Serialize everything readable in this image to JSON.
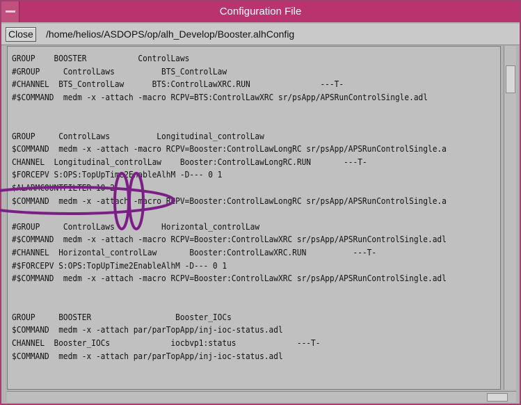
{
  "window": {
    "title": "Configuration File"
  },
  "toolbar": {
    "close_label": "Close",
    "file_path": "/home/helios/ASDOPS/op/alh_Develop/Booster.alhConfig"
  },
  "file_lines": [
    "GROUP    BOOSTER           ControlLaws",
    "#GROUP     ControlLaws          BTS_ControlLaw",
    "#CHANNEL  BTS_ControlLaw      BTS:ControlLawXRC.RUN               ---T-",
    "#$COMMAND  medm -x -attach -macro RCPV=BTS:ControlLawXRC sr/psApp/APSRunControlSingle.adl",
    "",
    "",
    "GROUP     ControlLaws          Longitudinal_controlLaw",
    "$COMMAND  medm -x -attach -macro RCPV=Booster:ControlLawLongRC sr/psApp/APSRunControlSingle.a",
    "CHANNEL  Longitudinal_controlLaw    Booster:ControlLawLongRC.RUN       ---T-",
    "$FORCEPV S:OPS:TopUpTime2EnableAlhM -D--- 0 1",
    "$ALARMCOUNTFILTER 10 2",
    "$COMMAND  medm -x -attach -macro RCPV=Booster:ControlLawLongRC sr/psApp/APSRunControlSingle.a",
    "",
    "#GROUP     ControlLaws          Horizontal_controlLaw",
    "#$COMMAND  medm -x -attach -macro RCPV=Booster:ControlLawXRC sr/psApp/APSRunControlSingle.adl",
    "#CHANNEL  Horizontal_controlLaw       Booster:ControlLawXRC.RUN          ---T-",
    "#$FORCEPV S:OPS:TopUpTime2EnableAlhM -D--- 0 1",
    "#$COMMAND  medm -x -attach -macro RCPV=Booster:ControlLawXRC sr/psApp/APSRunControlSingle.adl",
    "",
    "",
    "GROUP     BOOSTER                  Booster_IOCs",
    "$COMMAND  medm -x -attach par/parTopApp/inj-ioc-status.adl",
    "CHANNEL  Booster_IOCs             iocbvp1:status             ---T-",
    "$COMMAND  medm -x -attach par/parTopApp/inj-ioc-status.adl"
  ],
  "annotation": {
    "color": "#7b1f86"
  }
}
